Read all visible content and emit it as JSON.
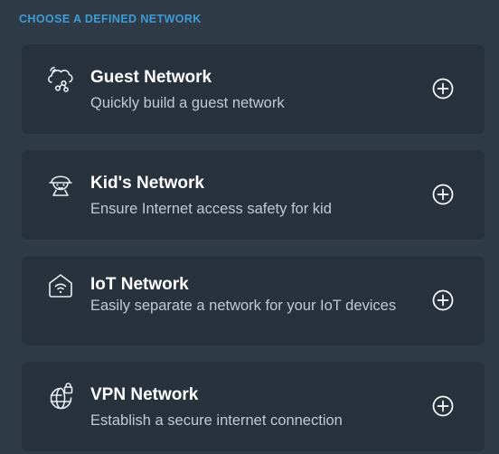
{
  "section": {
    "title": "CHOOSE A DEFINED NETWORK"
  },
  "networks": [
    {
      "title": "Guest Network",
      "description": "Quickly build a guest network",
      "icon": "cloud-network-icon"
    },
    {
      "title": "Kid's Network",
      "description": "Ensure Internet access safety for kid",
      "icon": "kid-face-icon"
    },
    {
      "title": "IoT Network",
      "description": "Easily separate a network for your IoT devices",
      "icon": "smart-home-wifi-icon"
    },
    {
      "title": "VPN Network",
      "description": "Establish a secure internet connection",
      "icon": "globe-lock-icon"
    }
  ],
  "colors": {
    "background": "#2f3b47",
    "card": "#27323d",
    "accent": "#3f9bd6",
    "title": "#ffffff",
    "description": "#c0cad4"
  }
}
